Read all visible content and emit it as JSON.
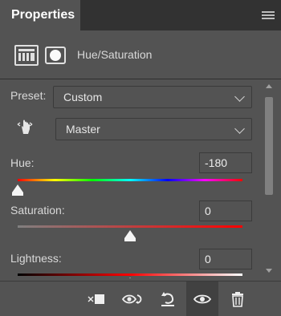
{
  "panel": {
    "tab_title": "Properties",
    "adjustment_title": "Hue/Saturation"
  },
  "preset": {
    "label": "Preset:",
    "value": "Custom"
  },
  "channel": {
    "value": "Master"
  },
  "hue": {
    "label": "Hue:",
    "value": "-180"
  },
  "saturation": {
    "label": "Saturation:",
    "value": "0"
  },
  "lightness": {
    "label": "Lightness:",
    "value": "0"
  },
  "icons": {
    "menu": "hamburger-menu-icon",
    "adjustment": "hue-saturation-icon",
    "mask": "layer-mask-icon",
    "targeted_adjust": "targeted-adjustment-hand-icon",
    "clip": "clip-to-layer-icon",
    "view_previous": "view-previous-state-icon",
    "reset": "reset-icon",
    "visibility": "visibility-eye-icon",
    "delete": "trash-icon"
  },
  "colors": {
    "panel_bg": "#535353",
    "tab_bg": "#323232"
  }
}
